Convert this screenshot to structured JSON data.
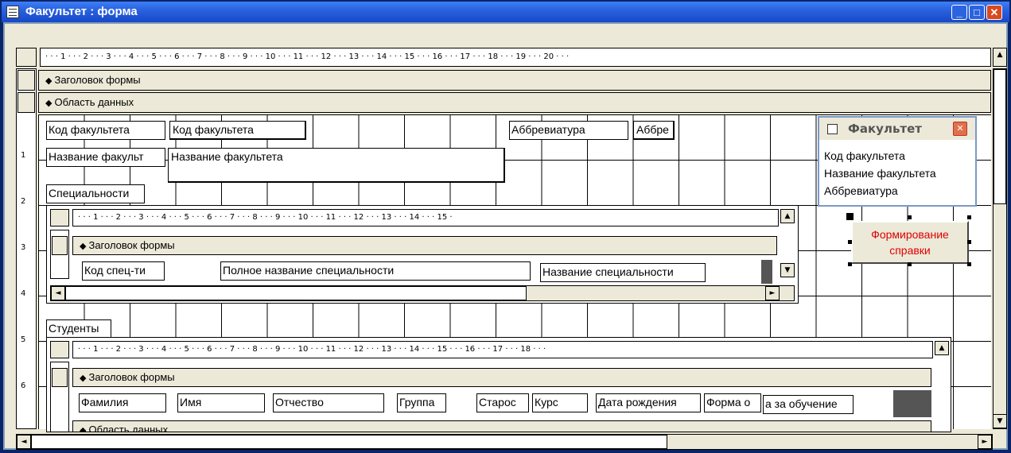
{
  "window": {
    "title": "Факультет : форма",
    "buttons": {
      "minimize": "_",
      "maximize": "□",
      "close": "✕"
    }
  },
  "ruler": {
    "main": "· · · 1 · · · 2 · · · 3 · · · 4 · · · 5 · · · 6 · · · 7 · · · 8 · · · 9 · · · 10 · · · 11 · · · 12 · · · 13 · · · 14 · · · 15 · · · 16 · · · 17 · · · 18 · · · 19 · · · 20 · · ·",
    "sub1": "· · · 1 · · · 2 · · · 3 · · · 4 · · · 5 · · · 6 · · · 7 · · · 8 · · · 9 · · · 10 · · · 11 · · · 12 · · · 13 · · · 14 · · · 15 ·",
    "sub2": "· · · 1 · · · 2 · · · 3 · · · 4 · · · 5 · · · 6 · · · 7 · · · 8 · · · 9 · · · 10 · · · 11 · · · 12 · · · 13 · · · 14 · · · 15 · · · 16 · · · 17 · · · 18 · · ·",
    "vertical": [
      "1",
      "2",
      "3",
      "4",
      "5",
      "6"
    ]
  },
  "sections": {
    "form_header": "Заголовок формы",
    "detail": "Область данных"
  },
  "main_form": {
    "code_label": "Код факультета",
    "code_field": "Код факультета",
    "abbr_label": "Аббревиатура",
    "abbr_field": "Аббре",
    "name_label": "Название факульт",
    "name_field": "Название факультета",
    "specialties_label": "Специальности",
    "students_label": "Студенты"
  },
  "subform_specialties": {
    "header": "Заголовок формы",
    "code_spec": "Код спец-ти",
    "full_name": "Полное название специальности",
    "spec_name": "Название специальности"
  },
  "subform_students": {
    "header": "Заголовок формы",
    "detail": "Область данных",
    "columns": [
      "Фамилия",
      "Имя",
      "Отчество",
      "Группа",
      "Старос",
      "Курс",
      "Дата рождения",
      "Форма о",
      "а за обучение"
    ]
  },
  "field_list": {
    "title": "Факультет",
    "items": [
      "Код факультета",
      "Название факультета",
      "Аббревиатура"
    ]
  },
  "command_button": {
    "line1": "Формирование",
    "line2": "справки"
  },
  "colors": {
    "title_bar": "#2a62e0",
    "button_text": "#e00000"
  }
}
